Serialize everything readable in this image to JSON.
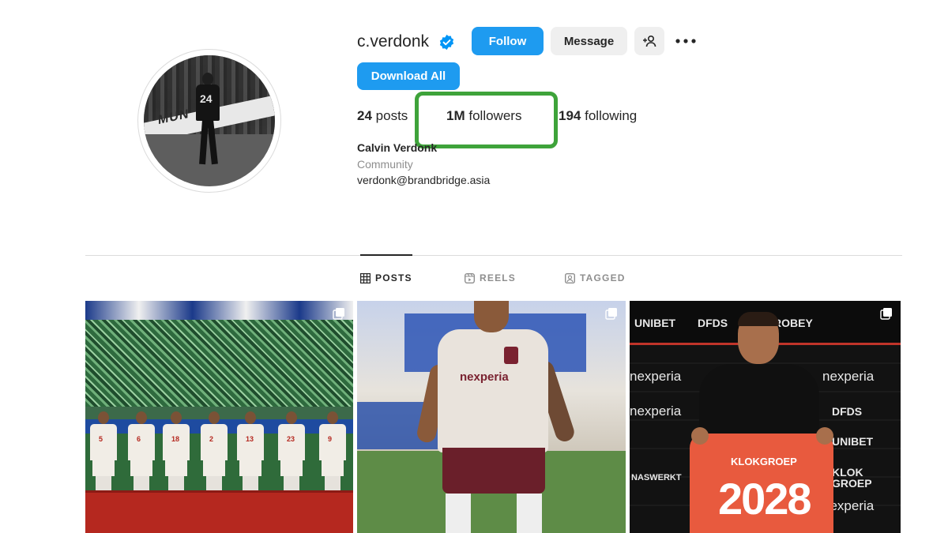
{
  "profile": {
    "username": "c.verdonk",
    "follow_label": "Follow",
    "message_label": "Message",
    "download_label": "Download All",
    "stats": {
      "posts_count": "24",
      "posts_label": "posts",
      "followers_count": "1M",
      "followers_label": "followers",
      "following_count": "194",
      "following_label": "following"
    },
    "full_name": "Calvin Verdonk",
    "category": "Community",
    "email": "verdonk@brandbridge.asia"
  },
  "avatar_art": {
    "board_text": "MUN"
  },
  "tabs": [
    {
      "label": "POSTS",
      "active": true
    },
    {
      "label": "REELS",
      "active": false
    },
    {
      "label": "TAGGED",
      "active": false
    }
  ],
  "posts": [
    {
      "jersey_numbers": [
        "5",
        "6",
        "18",
        "2",
        "13",
        "23",
        "9"
      ]
    },
    {
      "sponsor": "nexperia"
    },
    {
      "logos": [
        "UNIBET",
        "DFDS",
        "ROBEY",
        "nexperia",
        "nexperia",
        "nexperia",
        "nexperia",
        "DFDS",
        "UNIBET",
        "KLOK GROEP",
        "NASWERKT",
        "nexperia"
      ],
      "jersey_sponsor": "KLOKGROEP",
      "jersey_number": "2028"
    }
  ],
  "colors": {
    "primary_blue": "#1e9bf0",
    "highlight_green": "#3ea33a",
    "verified_blue": "#0095f6"
  }
}
